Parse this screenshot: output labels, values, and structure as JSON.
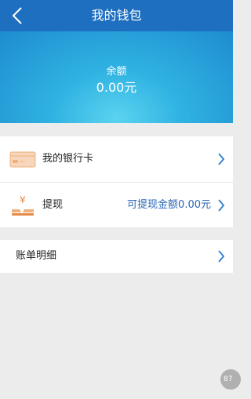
{
  "header": {
    "title": "我的钱包",
    "back_icon": "chevron-left-icon"
  },
  "balance": {
    "label": "余额",
    "value": "0.00元"
  },
  "menu": {
    "bank_card": {
      "label": "我的银行卡",
      "icon": "bank-card-icon"
    },
    "withdraw": {
      "label": "提现",
      "icon": "yuan-coins-icon",
      "extra": "可提现金额0.00元"
    },
    "bill": {
      "label": "账单明细"
    }
  },
  "floating_badge": "87",
  "colors": {
    "header_bg": "#1f6fc0",
    "balance_bg": "#2fb2e2",
    "accent_text": "#2a66b5",
    "chevron": "#2a7fd0",
    "icon_orange": "#f0b07a"
  }
}
